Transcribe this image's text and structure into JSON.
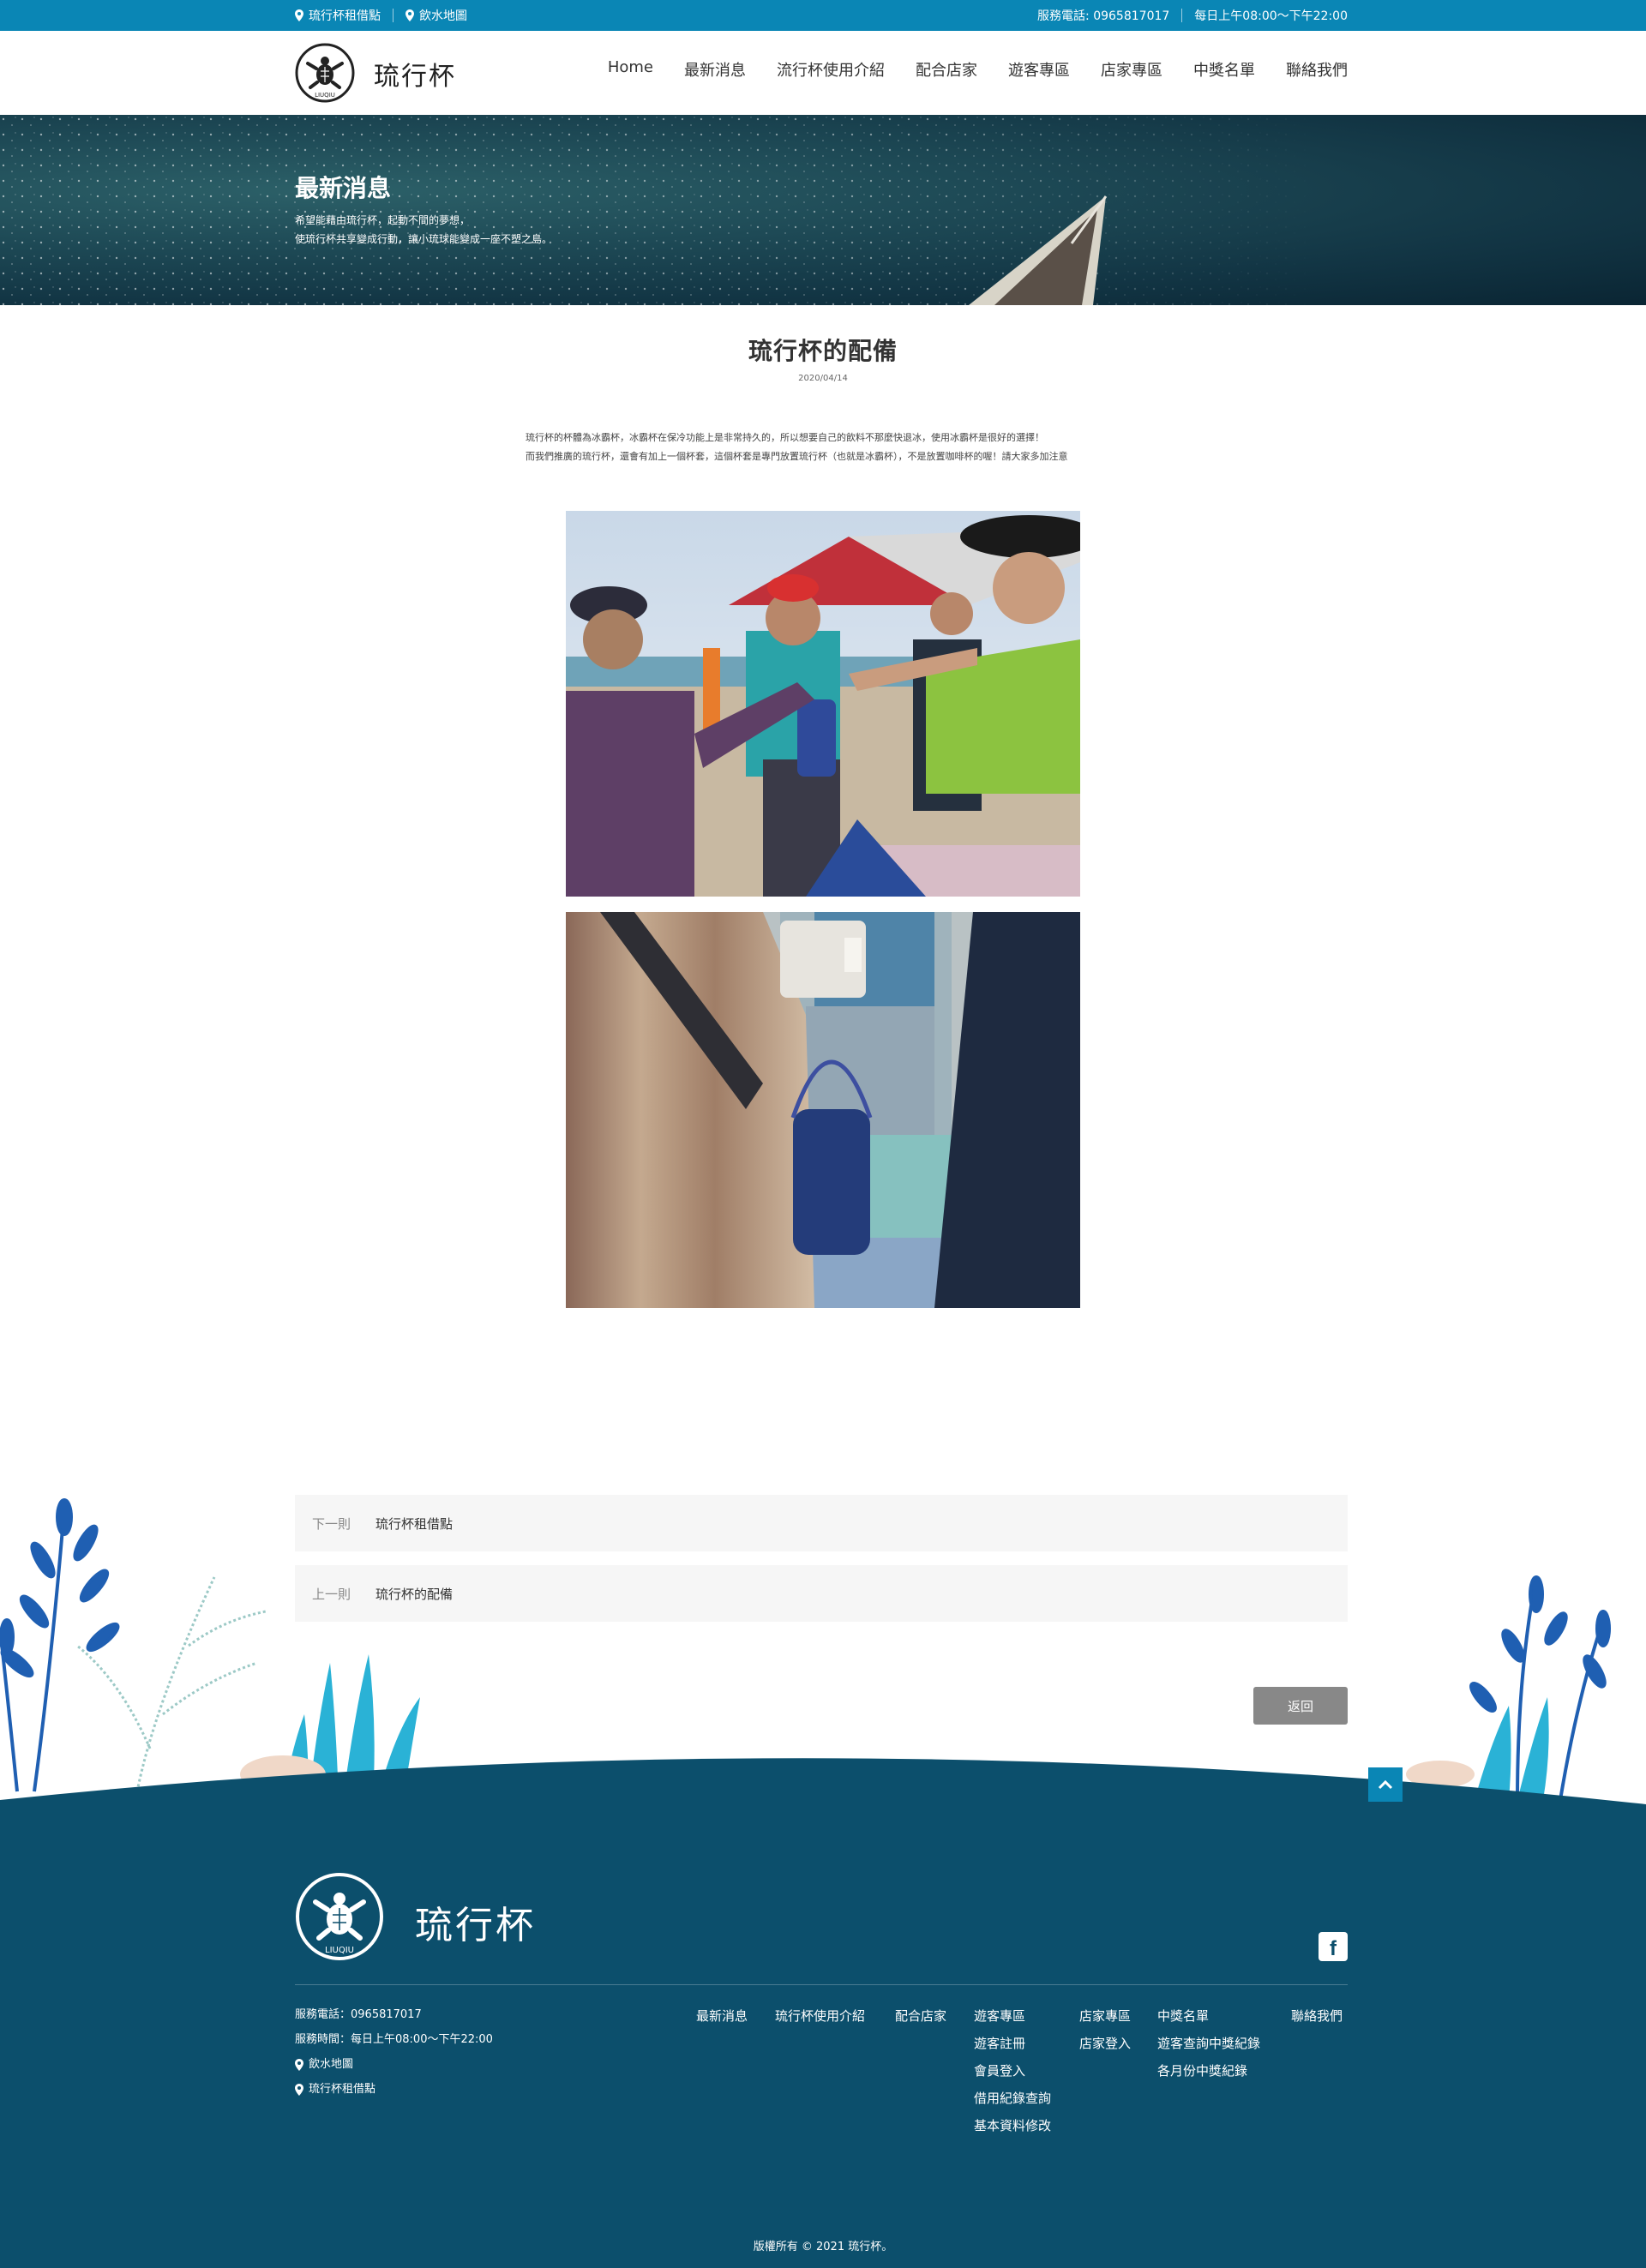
{
  "topbar": {
    "rental_label": "琉行杯租借點",
    "water_map_label": "飲水地圖",
    "phone_label": "服務電話: 0965817017",
    "hours_label": "每日上午08:00～下午22:00"
  },
  "header": {
    "brand": "琉行杯",
    "nav": [
      "Home",
      "最新消息",
      "流行杯使用介紹",
      "配合店家",
      "遊客專區",
      "店家專區",
      "中獎名單",
      "聯絡我們"
    ]
  },
  "hero": {
    "title": "最新消息",
    "subtitle_line1": "希望能藉由琉行杯，起動不間的夢想，",
    "subtitle_line2": "使琉行杯共享變成行動，讓小琉球能變成一座不塑之島。"
  },
  "article": {
    "title": "琉行杯的配備",
    "date": "2020/04/14",
    "paragraph1": "琉行杯的杯體為冰霸杯，冰霸杯在保冷功能上是非常持久的，所以想要自己的飲料不那麼快退冰，使用冰霸杯是很好的選擇！",
    "paragraph2": "而我們推廣的琉行杯，還會有加上一個杯套，這個杯套是專門放置琉行杯（也就是冰霸杯），不是放置咖啡杯的喔！請大家多加注意"
  },
  "pager": {
    "next_key": "下一則",
    "next_title": "琉行杯租借點",
    "prev_key": "上一則",
    "prev_title": "琉行杯的配備",
    "back_label": "返回"
  },
  "footer": {
    "brand": "琉行杯",
    "logo_text": "LIUQIU",
    "phone": "服務電話：0965817017",
    "hours": "服務時間：每日上午08:00～下午22:00",
    "water_map": "飲水地圖",
    "rental": "琉行杯租借點",
    "col_news": "最新消息",
    "col_intro": "琉行杯使用介紹",
    "col_stores": "配合店家",
    "col_visitor": [
      "遊客專區",
      "遊客註冊",
      "會員登入",
      "借用紀錄查詢",
      "基本資料修改"
    ],
    "col_store": [
      "店家專區",
      "店家登入"
    ],
    "col_prize": [
      "中獎名單",
      "遊客查詢中獎紀錄",
      "各月份中獎紀錄"
    ],
    "col_contact": "聯絡我們",
    "copyright": "版權所有 © 2021 琉行杯。"
  },
  "colors": {
    "topbar": "#0a86b5",
    "footer": "#0c4f6c",
    "button": "#888888"
  },
  "icons": [
    "location-pin-icon",
    "turtle-logo-icon",
    "facebook-icon",
    "chevron-up-icon"
  ]
}
